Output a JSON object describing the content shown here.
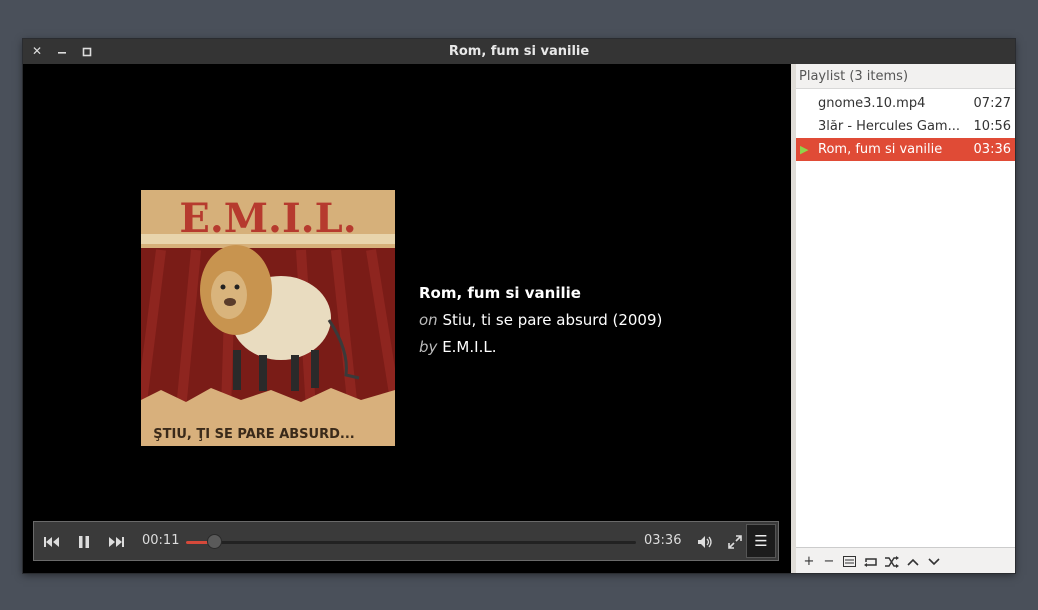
{
  "window": {
    "title": "Rom, fum si vanilie"
  },
  "track": {
    "title": "Rom, fum si vanilie",
    "on_prefix": "on",
    "album": "Stiu, ti se pare absurd (2009)",
    "by_prefix": "by",
    "artist": "E.M.I.L."
  },
  "album_art": {
    "header_text": "E.M.I.L.",
    "footer_text": "ŞTIU, ŢI SE PARE ABSURD..."
  },
  "controls": {
    "elapsed": "00:11",
    "total": "03:36",
    "progress_fraction": 0.051
  },
  "playlist": {
    "header": "Playlist (3 items)",
    "items": [
      {
        "name": "gnome3.10.mp4",
        "duration": "07:27",
        "active": false
      },
      {
        "name": "3lăr - Hercules Gam...",
        "duration": "10:56",
        "active": false
      },
      {
        "name": "Rom, fum si vanilie",
        "duration": "03:36",
        "active": true
      }
    ]
  },
  "colors": {
    "accent": "#e04b36",
    "progress": "#d5493a",
    "playing_indicator": "#8fd44a"
  },
  "icons": [
    "close-icon",
    "minimize-icon",
    "maximize-icon",
    "previous-icon",
    "pause-icon",
    "next-icon",
    "volume-icon",
    "fullscreen-icon",
    "menu-icon",
    "add-icon",
    "remove-icon",
    "clear-icon",
    "repeat-icon",
    "shuffle-icon",
    "move-up-icon",
    "move-down-icon"
  ]
}
